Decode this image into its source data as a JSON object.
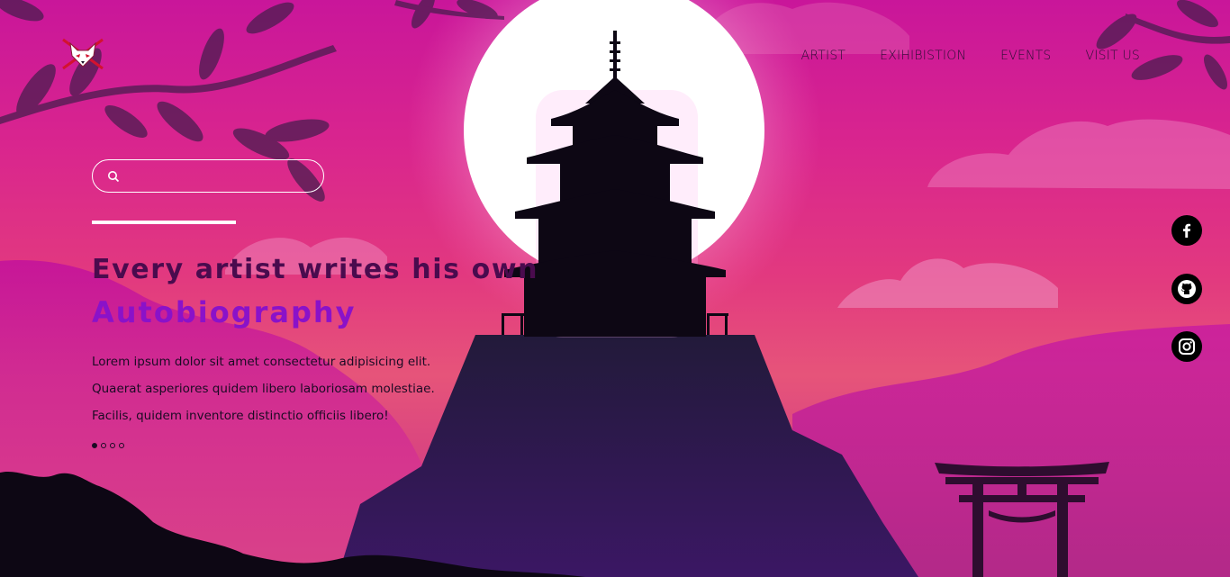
{
  "nav": {
    "items": [
      {
        "label": "ARTIST"
      },
      {
        "label": "EXIHIBISTION"
      },
      {
        "label": "EVENTS"
      },
      {
        "label": "VISIT US"
      }
    ]
  },
  "search": {
    "placeholder": "",
    "value": ""
  },
  "hero": {
    "heading_line1": "Every artist writes his own",
    "heading_line2": "Autobiography",
    "paragraph": [
      "Lorem ipsum dolor sit amet consectetur adipisicing elit.",
      "Quaerat asperiores quidem libero laboriosam molestiae.",
      "Facilis, quidem inventore distinctio officiis libero!"
    ],
    "slides": {
      "total": 4,
      "active": 1
    }
  },
  "social": [
    {
      "icon": "facebook-icon"
    },
    {
      "icon": "github-icon"
    },
    {
      "icon": "instagram-icon"
    }
  ],
  "colors": {
    "heading_dark": "#4a0b4e",
    "heading_accent": "#8a12c9",
    "sky_top": "#c9169a",
    "sky_mid": "#e2397f",
    "silhouette": "#0d0714"
  }
}
